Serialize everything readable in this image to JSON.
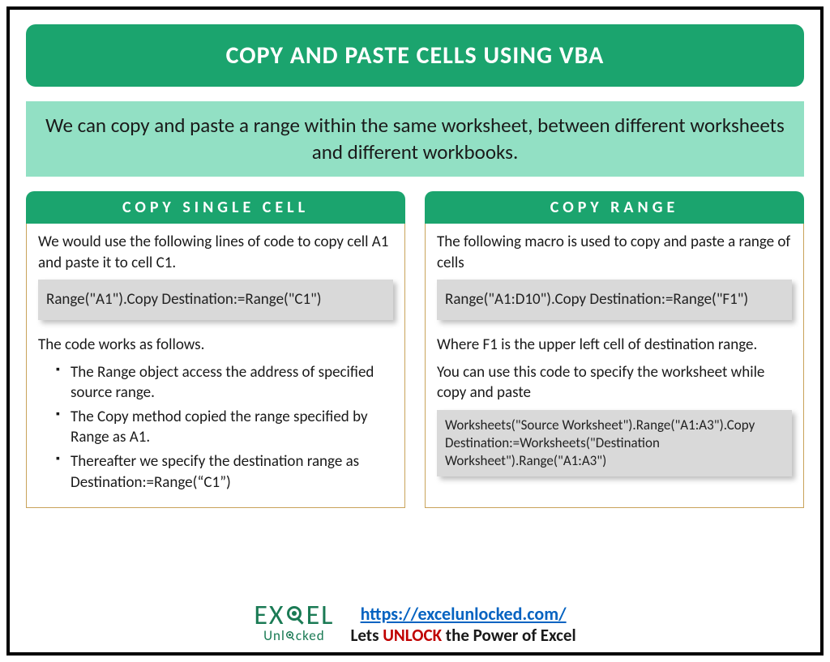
{
  "title": "COPY AND PASTE CELLS USING VBA",
  "subtitle": "We can copy and paste a range within the same worksheet, between different worksheets and different workbooks.",
  "left": {
    "header": "COPY SINGLE CELL",
    "intro": "We would use the following lines of code to copy cell A1 and paste it to cell C1.",
    "code": "Range(\"A1\").Copy Destination:=Range(\"C1\")",
    "explain_lead": "The code works as follows.",
    "bullets": {
      "b1": "The Range object access the address of specified source range.",
      "b2": "The Copy method copied the range specified by Range as A1.",
      "b3": "Thereafter we specify the destination range as Destination:=Range(“C1”)"
    }
  },
  "right": {
    "header": "COPY RANGE",
    "intro": "The following macro is used to copy and paste a range of cells",
    "code": "Range(\"A1:D10\").Copy Destination:=Range(\"F1\")",
    "explain1": "Where F1 is the upper left cell of destination range.",
    "explain2": "You can use this code to specify the worksheet while copy and paste",
    "code2": "Worksheets(\"Source Worksheet\").Range(\"A1:A3\").Copy Destination:=Worksheets(\"Destination Worksheet\").Range(\"A1:A3\")"
  },
  "footer": {
    "logo_top_1": "EX",
    "logo_top_2": "EL",
    "logo_bottom": "Unl",
    "logo_bottom_2": "cked",
    "link": "https://excelunlocked.com/",
    "tagline_1": "Lets ",
    "tagline_unlock": "UNLOCK",
    "tagline_2": " the Power of Excel"
  }
}
